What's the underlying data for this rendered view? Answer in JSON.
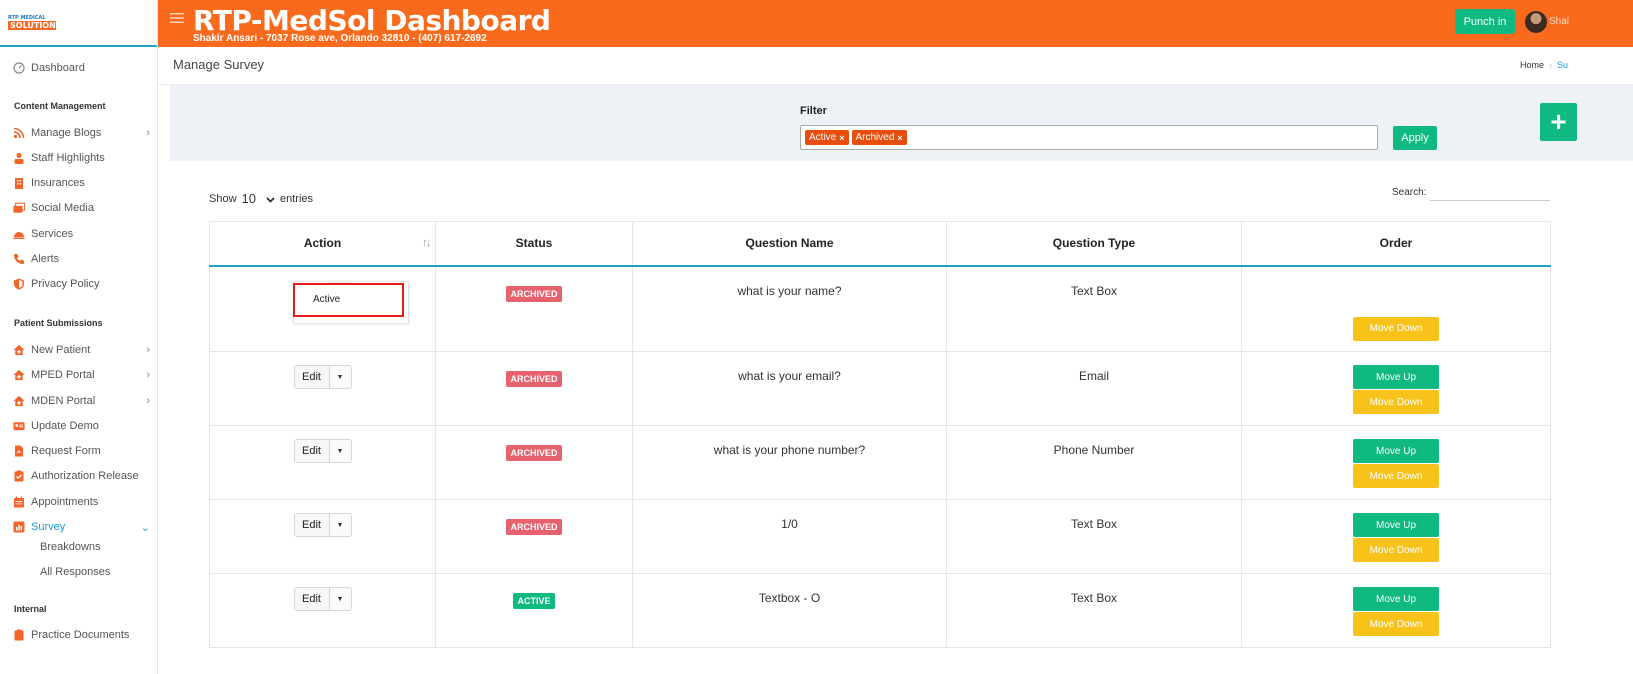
{
  "logo": {
    "line1": "RTP MEDICAL",
    "line2": "SOLUTION"
  },
  "topbar": {
    "title": "RTP-MedSol Dashboard",
    "subtitle": "Shakir Ansari - 7037 Rose ave, Orlando 32810 - (407) 617-2692",
    "punch_label": "Punch in",
    "username": "Shal"
  },
  "sidebar": {
    "dashboard": "Dashboard",
    "section_content": "Content Management",
    "content_items": [
      "Manage Blogs",
      "Staff Highlights",
      "Insurances",
      "Social Media",
      "Services",
      "Alerts",
      "Privacy Policy"
    ],
    "section_patient": "Patient Submissions",
    "patient_items": [
      "New Patient",
      "MPED Portal",
      "MDEN Portal",
      "Update Demo",
      "Request Form",
      "Authorization Release",
      "Appointments",
      "Survey"
    ],
    "survey_sub": [
      "Breakdowns",
      "All Responses"
    ],
    "section_internal": "Internal",
    "internal_items": [
      "Practice Documents"
    ]
  },
  "page": {
    "title": "Manage Survey",
    "breadcrumb_home": "Home",
    "breadcrumb_current": "Su"
  },
  "filter": {
    "label": "Filter",
    "tags": [
      "Active",
      "Archived"
    ],
    "apply_label": "Apply",
    "add_label": "+"
  },
  "table_controls": {
    "show_label": "Show",
    "entries_value": "10",
    "entries_label": "entries",
    "search_label": "Search:"
  },
  "table": {
    "headers": [
      "Action",
      "Status",
      "Question Name",
      "Question Type",
      "Order"
    ],
    "edit_label": "Edit",
    "move_up_label": "Move Up",
    "move_down_label": "Move Down",
    "dropdown_option": "Active",
    "rows": [
      {
        "status": "ARCHIVED",
        "question": "what is your name?",
        "type": "Text Box"
      },
      {
        "status": "ARCHIVED",
        "question": "what is your email?",
        "type": "Email"
      },
      {
        "status": "ARCHIVED",
        "question": "what is your phone number?",
        "type": "Phone Number"
      },
      {
        "status": "ARCHIVED",
        "question": "1/0",
        "type": "Text Box"
      },
      {
        "status": "ACTIVE",
        "question": "Textbox - O",
        "type": "Text Box"
      }
    ]
  },
  "colors": {
    "brand": "#fa6a1c",
    "accent": "#10b981",
    "warning": "#f7c21a",
    "archived": "#e8616f",
    "link": "#1b9ad6"
  }
}
